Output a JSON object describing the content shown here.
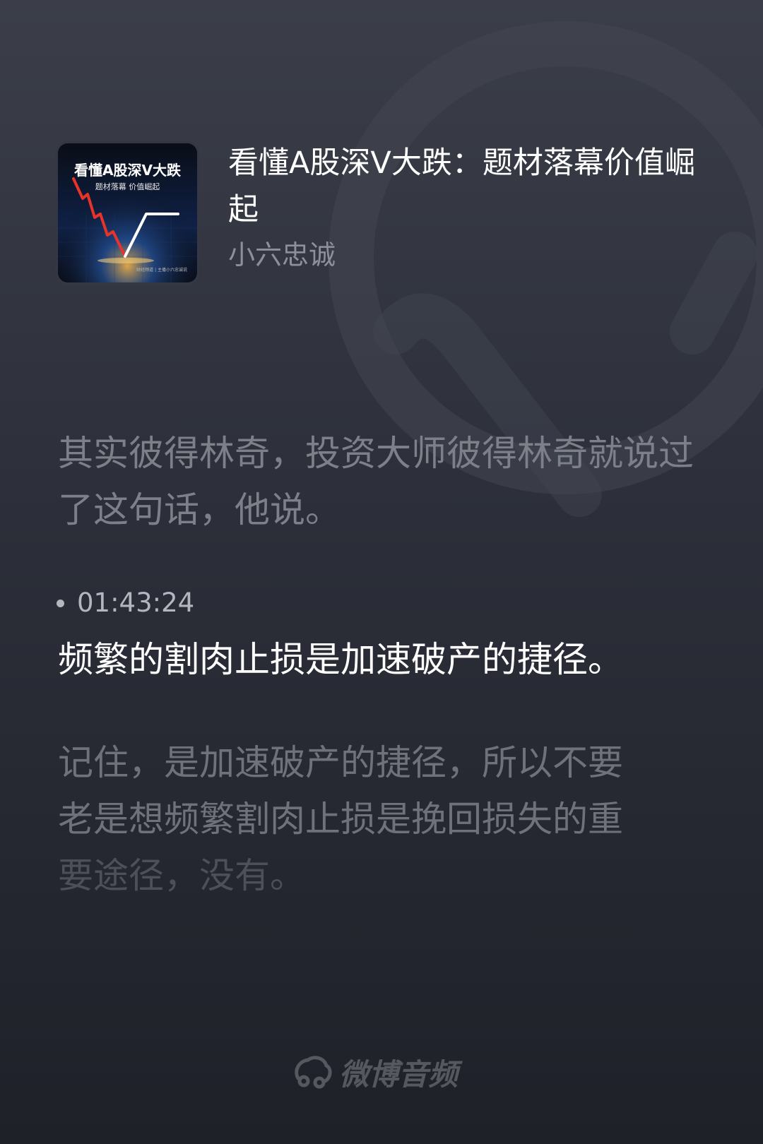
{
  "album": {
    "cover_title": "看懂A股深V大跌",
    "cover_subtitle": "题材落幕 价值崛起",
    "cover_footer": "财经频道 | 主播小六忠诚说",
    "title": "看懂A股深V大跌：题材落幕价值崛起",
    "author": "小六忠诚"
  },
  "transcript": {
    "previous": "其实彼得林奇，投资大师彼得林奇就说过了这句话，他说。",
    "timestamp": "01:43:24",
    "current": "频繁的割肉止损是加速破产的捷径。",
    "next_lines": [
      "记住，是加速破产的捷径，所以不要",
      "老是想频繁割肉止损是挽回损失的重",
      "要途径，没有。"
    ]
  },
  "brand": {
    "name": "微博音频",
    "icon": "weibo-audio-logo-icon"
  },
  "colors": {
    "accent_red": "#e8332a",
    "accent_white": "#ffffff",
    "glow": "#f5b54a"
  }
}
